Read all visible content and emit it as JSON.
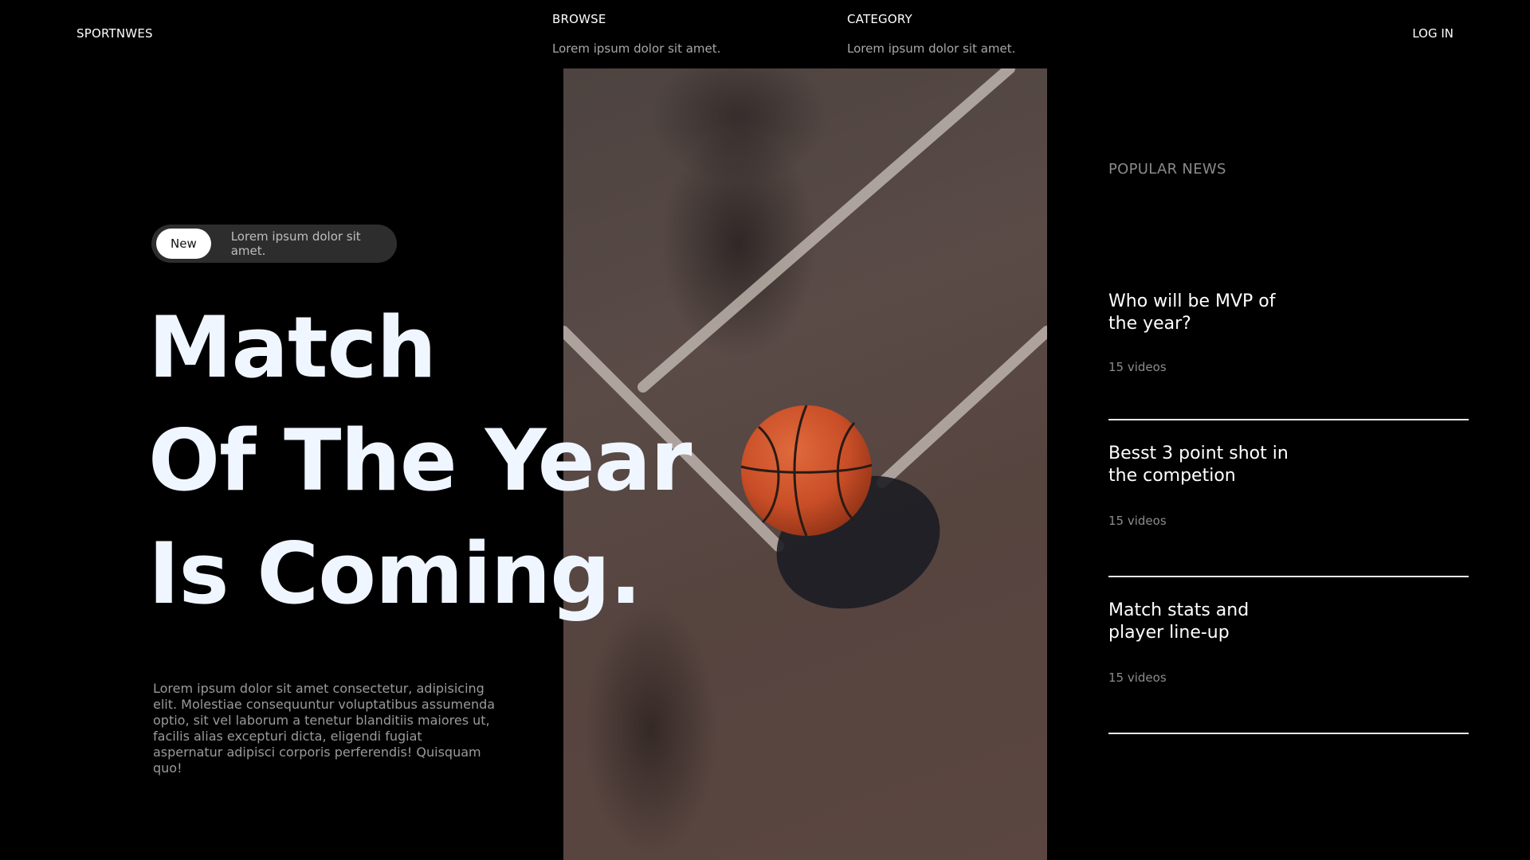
{
  "header": {
    "logo": "SPORTNWES",
    "nav": [
      {
        "title": "BROWSE",
        "subtitle": "Lorem ipsum dolor sit amet."
      },
      {
        "title": "CATEGORY",
        "subtitle": "Lorem ipsum dolor sit amet."
      }
    ],
    "login_label": "LOG IN"
  },
  "hero": {
    "badge_label": "New",
    "badge_text": "Lorem ipsum dolor sit amet.",
    "headline": [
      "Match",
      "Of The Year",
      "Is Coming."
    ],
    "lead": "Lorem ipsum dolor sit amet consectetur, adipisicing elit. Molestiae consequuntur voluptatibus assumenda optio, sit vel laborum a tenetur blanditiis maiores ut, facilis alias excepturi dicta, eligendi fugiat aspernatur adipisci corporis perferendis! Quisquam quo!",
    "image_subject": "basketball-on-court"
  },
  "popular": {
    "title": "POPULAR NEWS",
    "items": [
      {
        "title": "Who will be MVP of the year?",
        "count": "15 videos"
      },
      {
        "title": "Besst 3 point shot in the competion",
        "count": "15 videos"
      },
      {
        "title": "Match stats and player line-up",
        "count": "15 videos"
      }
    ]
  },
  "colors": {
    "background": "#000000",
    "headline": "#f0f6ff",
    "ball": "#d2552c",
    "court": "#564540"
  }
}
